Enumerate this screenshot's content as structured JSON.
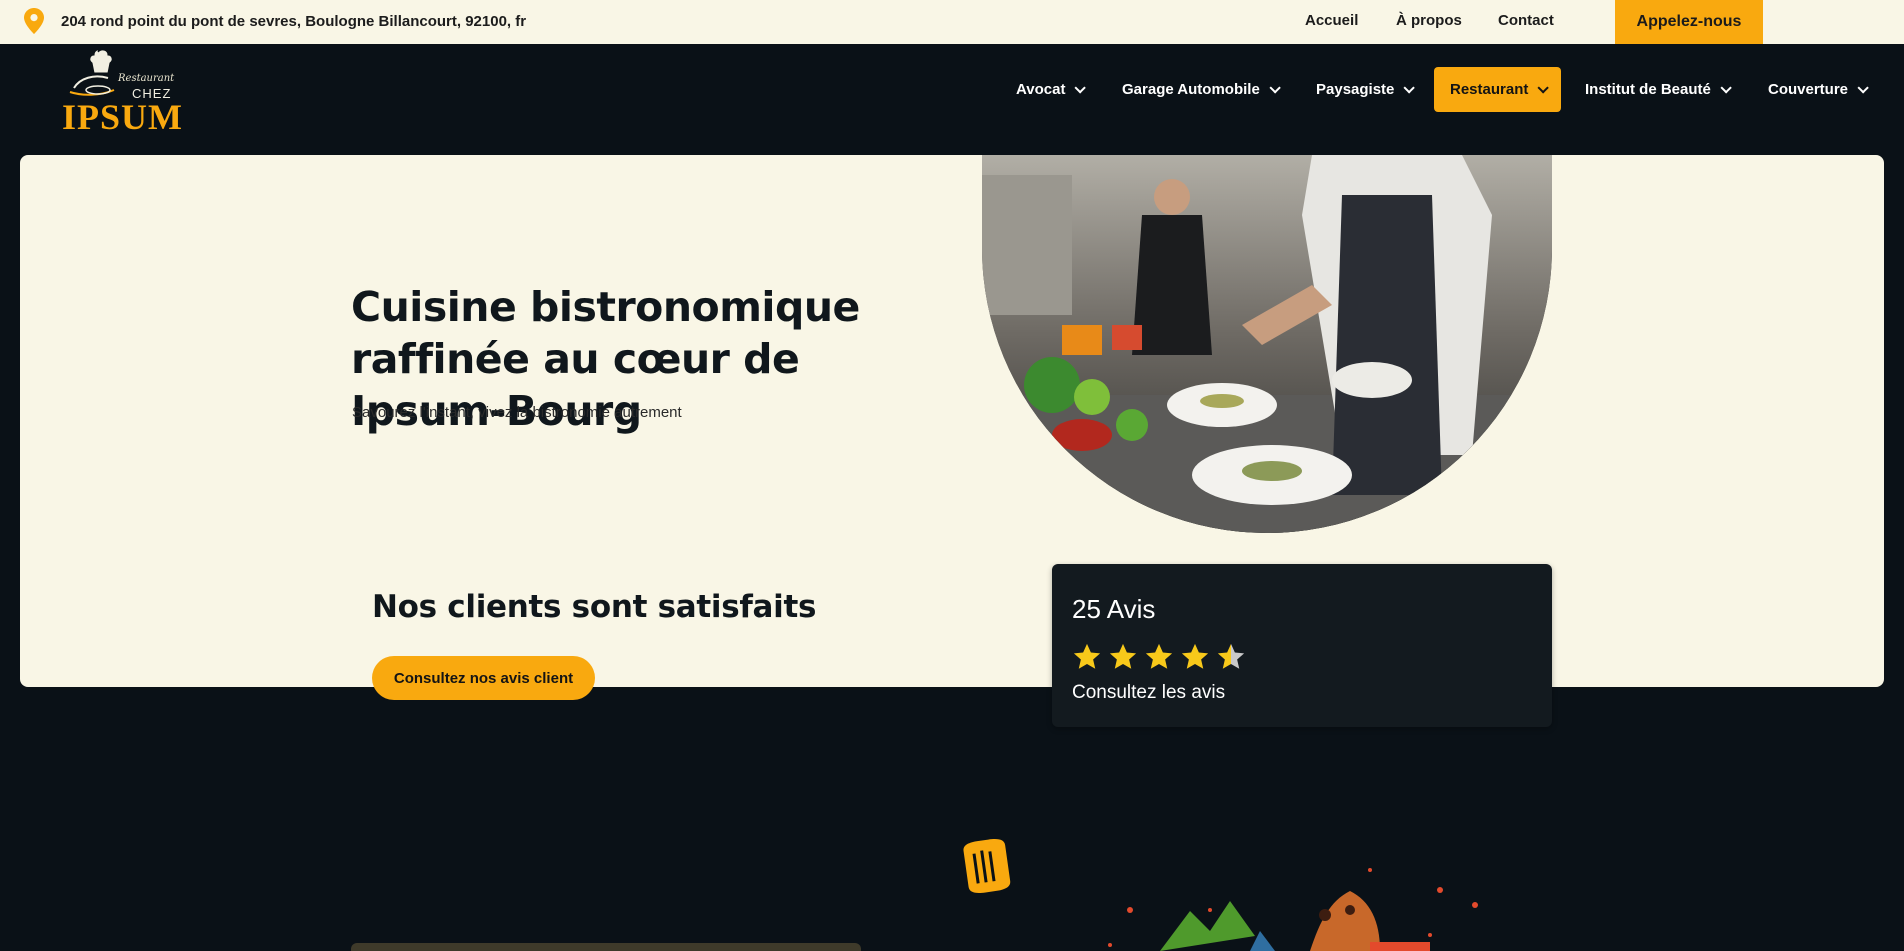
{
  "topbar": {
    "address": "204 rond point du pont de sevres, Boulogne Billancourt, 92100, fr",
    "links": [
      "Accueil",
      "À propos",
      "Contact"
    ],
    "call_button": "Appelez-nous"
  },
  "logo": {
    "line1": "Restaurant",
    "line2": "CHEZ",
    "line3": "IPSUM"
  },
  "nav": {
    "items": [
      {
        "label": "Avocat"
      },
      {
        "label": "Garage Automobile"
      },
      {
        "label": "Paysagiste"
      },
      {
        "label": "Restaurant",
        "active": true
      },
      {
        "label": "Institut de Beauté"
      },
      {
        "label": "Couverture"
      }
    ]
  },
  "hero": {
    "title": "Cuisine bistronomique raffinée au cœur de Ipsum-Bourg",
    "subtitle": "Savourez l'instant, vivez la bistronomie autrement"
  },
  "reviews": {
    "heading": "Nos clients sont satisfaits",
    "button": "Consultez nos avis client",
    "count_label": "25 Avis",
    "rating": 4.5,
    "link": "Consultez les avis"
  },
  "colors": {
    "accent": "#f9a90f",
    "dark": "#0a1117",
    "cream": "#f9f6e6",
    "star": "#f8c91a"
  }
}
